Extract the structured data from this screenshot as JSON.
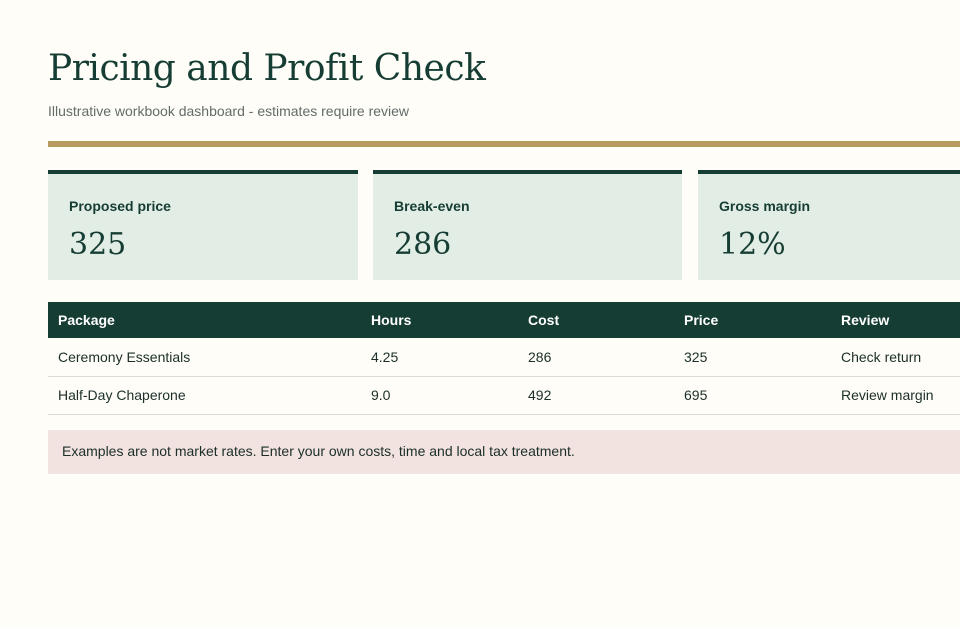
{
  "header": {
    "title": "Pricing and Profit Check",
    "subtitle": "Illustrative workbook dashboard - estimates require review"
  },
  "kpis": [
    {
      "label": "Proposed price",
      "value": "325"
    },
    {
      "label": "Break-even",
      "value": "286"
    },
    {
      "label": "Gross margin",
      "value": "12%"
    }
  ],
  "table": {
    "columns": [
      "Package",
      "Hours",
      "Cost",
      "Price",
      "Review"
    ],
    "rows": [
      [
        "Ceremony Essentials",
        "4.25",
        "286",
        "325",
        "Check return"
      ],
      [
        "Half-Day Chaperone",
        "9.0",
        "492",
        "695",
        "Review margin"
      ]
    ]
  },
  "note": "Examples are not market rates. Enter your own costs, time and local tax treatment.",
  "colors": {
    "primary": "#163d33",
    "accent": "#b89a5e",
    "card_bg": "#e2ede6",
    "note_bg": "#f2e3e0",
    "page_bg": "#fefdf8"
  }
}
